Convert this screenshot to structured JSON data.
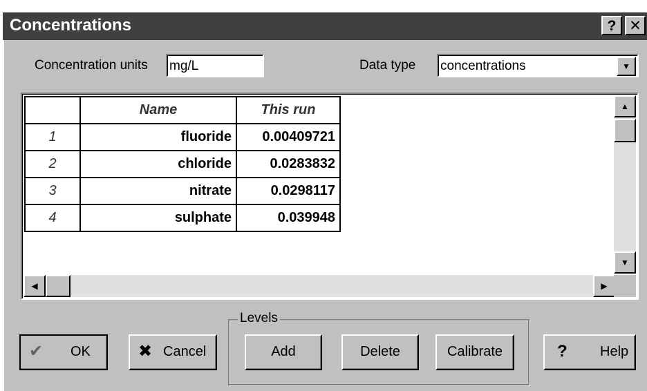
{
  "window": {
    "title": "Concentrations",
    "help_btn": "?",
    "close_btn": "✕"
  },
  "units": {
    "label": "Concentration units",
    "value": "mg/L"
  },
  "data_type": {
    "label": "Data type",
    "selected": "concentrations"
  },
  "grid": {
    "headers": [
      "",
      "Name",
      "This run"
    ],
    "rows": [
      {
        "num": "1",
        "name": "fluoride",
        "value": "0.00409721"
      },
      {
        "num": "2",
        "name": "chloride",
        "value": "0.0283832"
      },
      {
        "num": "3",
        "name": "nitrate",
        "value": "0.0298117"
      },
      {
        "num": "4",
        "name": "sulphate",
        "value": "0.039948"
      }
    ]
  },
  "levels": {
    "label": "Levels",
    "add": "Add",
    "delete": "Delete",
    "calibrate": "Calibrate"
  },
  "buttons": {
    "ok": "OK",
    "cancel": "Cancel",
    "help": "Help"
  },
  "icons": {
    "ok": "checkmark-icon",
    "cancel": "x-icon",
    "help": "question-icon"
  }
}
